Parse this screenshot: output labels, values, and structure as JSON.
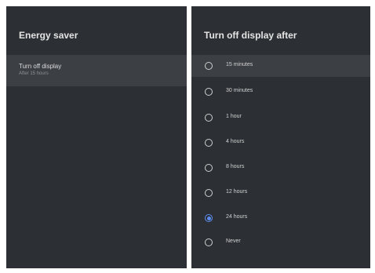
{
  "left_panel": {
    "title": "Energy saver",
    "item": {
      "label": "Turn off display",
      "sublabel": "After 15 hours"
    }
  },
  "right_panel": {
    "title": "Turn off display after",
    "options": [
      {
        "label": "15 minutes",
        "selected": false,
        "focused": true
      },
      {
        "label": "30 minutes",
        "selected": false,
        "focused": false
      },
      {
        "label": "1 hour",
        "selected": false,
        "focused": false
      },
      {
        "label": "4 hours",
        "selected": false,
        "focused": false
      },
      {
        "label": "8 hours",
        "selected": false,
        "focused": false
      },
      {
        "label": "12 hours",
        "selected": false,
        "focused": false
      },
      {
        "label": "24 hours",
        "selected": true,
        "focused": false
      },
      {
        "label": "Never",
        "selected": false,
        "focused": false
      }
    ]
  },
  "colors": {
    "panel_bg": "#2c2f33",
    "highlight_bg": "#3c3f44",
    "accent": "#5b8def"
  }
}
